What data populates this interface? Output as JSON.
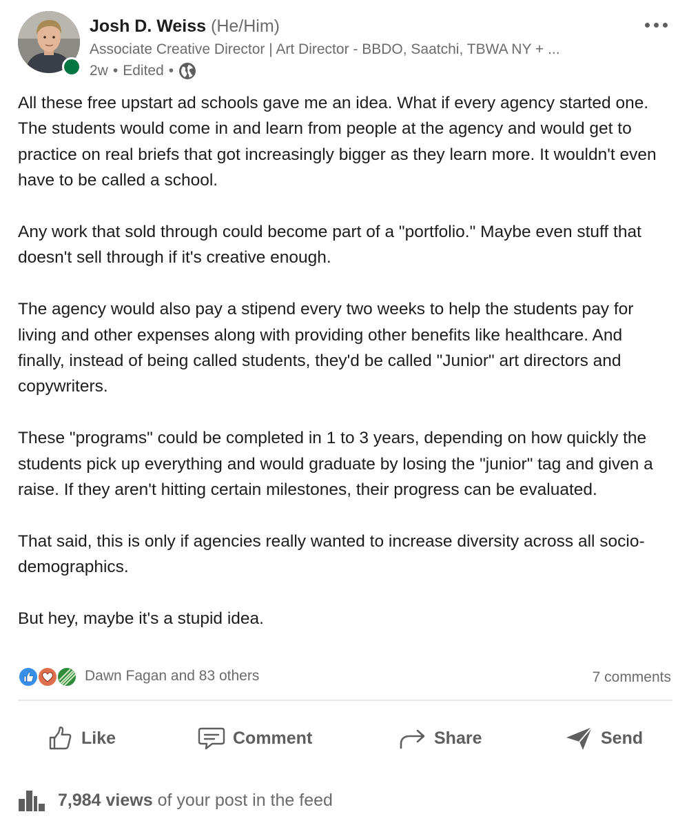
{
  "author": {
    "name": "Josh D. Weiss",
    "pronouns": "(He/Him)",
    "headline": "Associate Creative Director | Art Director - BBDO, Saatchi, TBWA NY + ...",
    "time": "2w",
    "edited": "Edited",
    "separator": "•",
    "visibility_icon": "globe-icon",
    "presence_color": "#057642"
  },
  "post": {
    "paragraphs": [
      "All these free upstart ad schools gave me an idea. What if every agency started one. The students would come in and learn from people at the agency and would get to practice on real briefs that got increasingly bigger as they learn more. It wouldn't even have to be called a school.",
      "Any work that sold through could become part of a \"portfolio.\" Maybe even stuff that doesn't sell through if it's creative enough.",
      "The agency would also pay a stipend every two weeks to help the students pay for living and other expenses along with providing other benefits like healthcare. And finally, instead of being called students, they'd be called \"Junior\" art directors and copywriters.",
      "These \"programs\" could be completed in 1 to 3 years, depending on how quickly the students pick up everything and would graduate by losing the \"junior\" tag and given a raise. If they aren't hitting certain milestones, their progress can be evaluated.",
      "That said, this is only if agencies really wanted to increase diversity across all socio-demographics.",
      "But hey, maybe it's a stupid idea."
    ]
  },
  "social": {
    "reaction_icons": [
      "like-reaction-icon",
      "love-reaction-icon",
      "insightful-reaction-icon"
    ],
    "reactors": "Dawn Fagan and 83 others",
    "comments": "7 comments"
  },
  "actions": {
    "like": "Like",
    "comment": "Comment",
    "share": "Share",
    "send": "Send"
  },
  "views": {
    "count": "7,984 views",
    "suffix": "of your post in the feed"
  },
  "colors": {
    "like_blue": "#378fe9",
    "love_red": "#df704d",
    "insightful_green": "#2f8a3c",
    "text": "#1d1d1d",
    "muted": "#6b6b6b"
  }
}
